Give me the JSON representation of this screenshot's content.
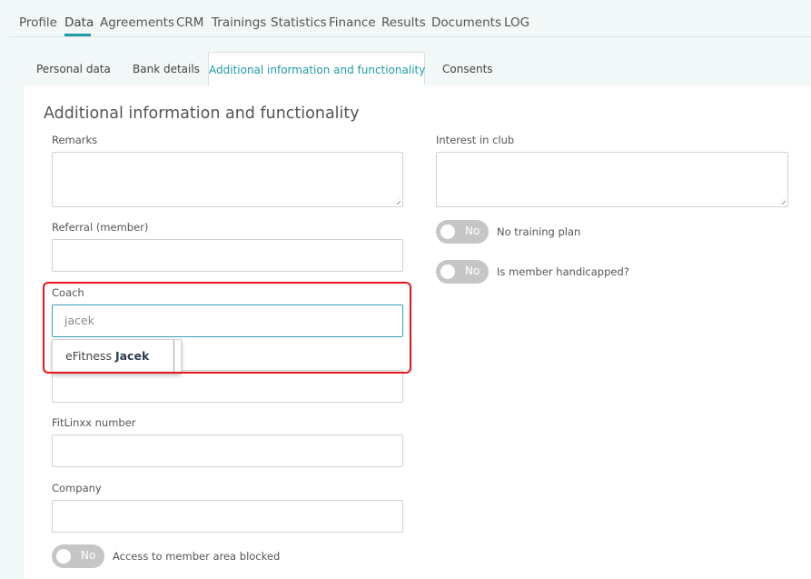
{
  "top_nav": {
    "items": [
      "Profile",
      "Data",
      "Agreements",
      "CRM",
      "Trainings",
      "Statistics",
      "Finance",
      "Results",
      "Documents",
      "LOG"
    ],
    "active": "Data"
  },
  "subtabs": {
    "items": [
      "Personal data",
      "Bank details",
      "Additional information and functionality",
      "Consents"
    ],
    "active": "Additional information and functionality"
  },
  "panel": {
    "title": "Additional information and functionality",
    "remarks_label": "Remarks",
    "remarks_value": "",
    "interest_label": "Interest in club",
    "interest_value": "",
    "referral_label": "Referral (member)",
    "referral_value": "",
    "coach_label": "Coach",
    "coach_value": "jacek",
    "coach_suggestion_prefix": "eFitness ",
    "coach_suggestion_match": "Jacek",
    "fitlinxx_label": "FitLinxx number",
    "fitlinxx_value": "",
    "company_label": "Company",
    "company_value": ""
  },
  "toggles": {
    "no_training_plan": {
      "state": "No",
      "label": "No training plan"
    },
    "handicapped": {
      "state": "No",
      "label": "Is member handicapped?"
    },
    "access_blocked": {
      "state": "No",
      "label": "Access to member area blocked"
    }
  },
  "colors": {
    "accent": "#1e9aa6",
    "highlight": "#e8141c",
    "toggle_off": "#c6c6c6",
    "background": "#f2f7f7"
  }
}
